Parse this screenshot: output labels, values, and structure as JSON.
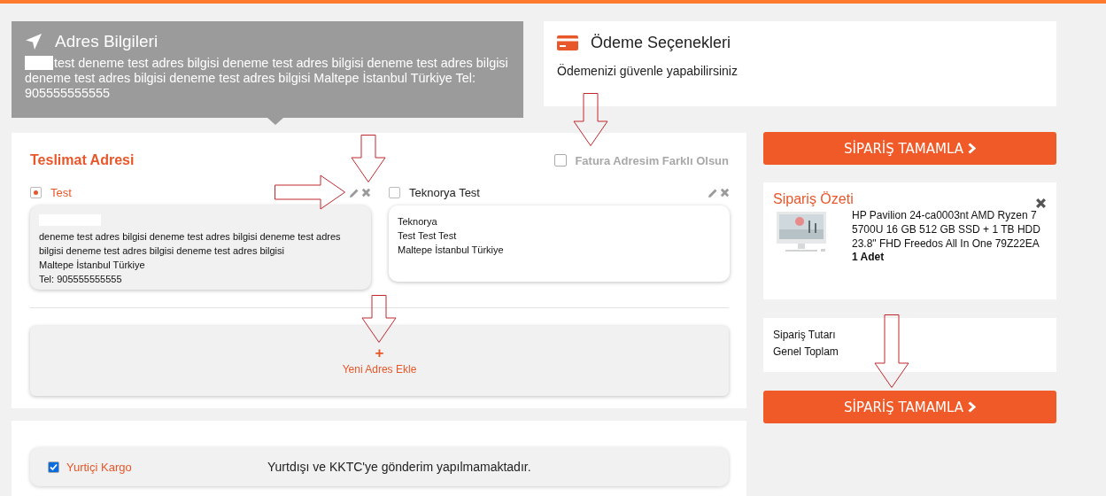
{
  "address_info": {
    "title": "Adres Bilgileri",
    "redacted": true,
    "text": "test deneme test adres bilgisi deneme test adres bilgisi deneme test adres bilgisi deneme test adres bilgisi deneme test adres bilgisi Maltepe İstanbul Türkiye Tel: 905555555555"
  },
  "payment": {
    "title": "Ödeme Seçenekleri",
    "subtitle": "Ödemenizi güvenle yapabilirsiniz"
  },
  "delivery": {
    "title": "Teslimat Adresi",
    "invoice_option": {
      "label": "Fatura Adresim Farklı Olsun",
      "checked": false
    },
    "addresses": [
      {
        "name": "Test",
        "selected": true,
        "redacted": true,
        "lines": [
          "deneme test adres bilgisi deneme test adres bilgisi deneme test adres bilgisi deneme test adres bilgisi deneme test adres bilgisi",
          "Maltepe İstanbul Türkiye",
          "Tel: 905555555555"
        ]
      },
      {
        "name": "Teknorya Test",
        "selected": false,
        "lines": [
          "Teknorya",
          "Test Test Test",
          "Maltepe İstanbul Türkiye"
        ]
      }
    ],
    "add_button": {
      "icon": "+",
      "label": "Yeni Adres Ekle"
    }
  },
  "shipping": {
    "options": [
      {
        "name": "Yurtiçi Kargo",
        "checked": true
      }
    ],
    "note": "Yurtdışı ve KKTC'ye gönderim yapılmamaktadır."
  },
  "complete_buttons": [
    {
      "label": "SİPARİŞ TAMAMLA"
    },
    {
      "label": "SİPARİŞ TAMAMLA"
    }
  ],
  "order_summary": {
    "title": "Sipariş Özeti",
    "items": [
      {
        "name": "HP Pavilion 24-ca0003nt AMD Ryzen 7 5700U 16 GB 512 GB SSD + 1 TB HDD 23.8\" FHD Freedos All In One 79Z22EA",
        "quantity": "1 Adet"
      }
    ]
  },
  "totals": [
    "Sipariş Tutarı",
    "Genel Toplam"
  ]
}
